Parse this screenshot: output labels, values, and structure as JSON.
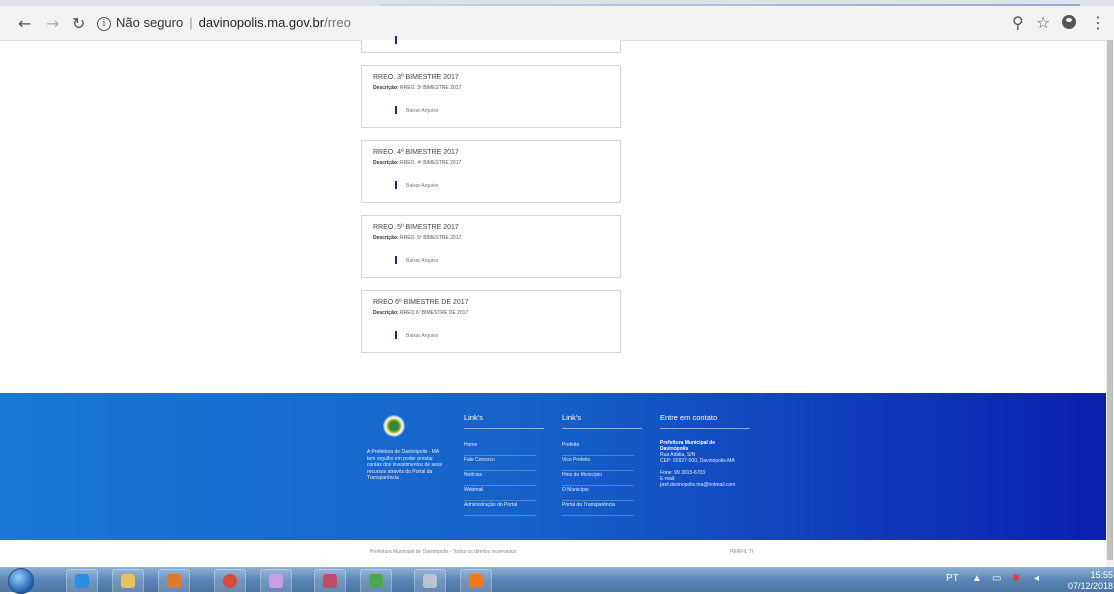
{
  "browser": {
    "security_label": "Não seguro",
    "url_host": "davinopolis.ma.gov.br",
    "url_path": "/rreo",
    "back_icon": "back-arrow-icon",
    "forward_icon": "forward-arrow-icon",
    "reload_icon": "reload-icon",
    "info_glyph": "i"
  },
  "cards": [
    {
      "title": "RREO. 3º BIMESTRE 2017",
      "desc_label": "Descrição:",
      "desc": "RREO. 3º BIMESTRE 2017",
      "download": "Baixar Arquivo"
    },
    {
      "title": "RREO. 4º BIMESTRE 2017",
      "desc_label": "Descrição:",
      "desc": "RREO. 4º BIMESTRE 2017",
      "download": "Baixar Arquivo"
    },
    {
      "title": "RREO. 5º BIMESTRE 2017",
      "desc_label": "Descrição:",
      "desc": "RREO. 5º BIMESTRE 2017",
      "download": "Baixar Arquivo"
    },
    {
      "title": "RREO 6º BIMESTRE DE 2017",
      "desc_label": "Descrição:",
      "desc": "RREO 6º BIMESTRE DE 2017",
      "download": "Baixar Arquivo"
    }
  ],
  "footer": {
    "about": "A Prefeitura de Davinópolis - MA tem orgulho em poder prestar contas dos investimentos de seus recursos através do Portal da Transparência",
    "links1": {
      "heading": "Link's",
      "items": [
        "Home",
        "Fale Conosco",
        "Notícias",
        "Webmail",
        "Administração do Portal"
      ]
    },
    "links2": {
      "heading": "Link's",
      "items": [
        "Prefeito",
        "Vice Prefeito",
        "Hino do Município",
        "O Município",
        "Portal da Transparência"
      ]
    },
    "contact": {
      "heading": "Entre em contato",
      "org_line1": "Prefeitura Municipal de",
      "org_line2": "Davinópolis",
      "address1": "Rua Adalia, S/N",
      "address2": "CEP: 65927-000, Davinópolis-MA",
      "phone": "Fone: 99 3015-6703",
      "email_label": "E-mail:",
      "email": "pref.davinopolis.ma@hotmail.com"
    },
    "copyright": "Prefeitura Municipal de Davinópolis - Todos os direitos reservados",
    "perfil": "PERFIL TI"
  },
  "taskbar": {
    "lang": "PT",
    "time": "15:55",
    "date": "07/12/2018"
  }
}
